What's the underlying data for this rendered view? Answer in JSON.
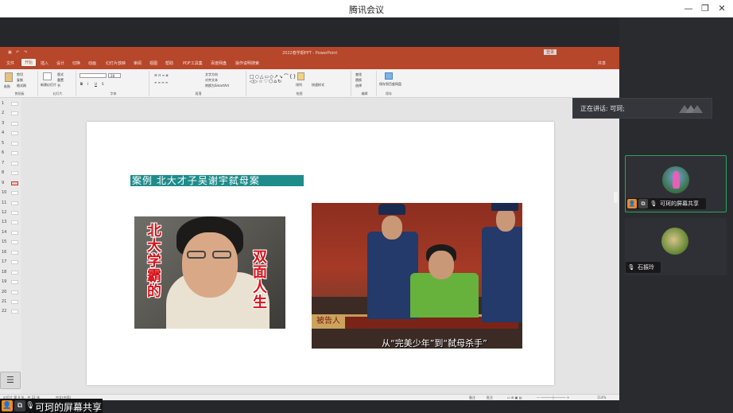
{
  "window": {
    "title": "腾讯会议",
    "minimize_glyph": "—",
    "restore_glyph": "❐",
    "close_glyph": "✕"
  },
  "ppt": {
    "title_center": "2022春学期PPT  -  PowerPoint",
    "signin": "登录",
    "share": "共享",
    "menu": [
      "文件",
      "开始",
      "插入",
      "设计",
      "切换",
      "动画",
      "幻灯片放映",
      "审阅",
      "视图",
      "帮助",
      "PDF工具集",
      "百度网盘",
      "操作说明搜索"
    ],
    "active_menu": "开始",
    "ribbon_groups": [
      {
        "label": "剪贴板",
        "items": [
          "粘贴",
          "剪切",
          "复制",
          "格式刷"
        ]
      },
      {
        "label": "幻灯片",
        "items": [
          "新建幻灯片",
          "版式",
          "重置",
          "节"
        ]
      },
      {
        "label": "字体",
        "items": [
          "B",
          "I",
          "U",
          "S",
          "28"
        ]
      },
      {
        "label": "段落",
        "items": [
          "文字方向",
          "对齐文本",
          "转换为SmartArt"
        ]
      },
      {
        "label": "绘图",
        "items": [
          "排列",
          "快速样式"
        ]
      },
      {
        "label": "编辑",
        "items": [
          "查找",
          "替换",
          "选择"
        ]
      },
      {
        "label": "保存",
        "items": [
          "保存到百度网盘"
        ]
      }
    ],
    "thumb_numbers": [
      "1",
      "2",
      "3",
      "4",
      "5",
      "6",
      "7",
      "8",
      "9",
      "10",
      "11",
      "12",
      "13",
      "14",
      "15",
      "16",
      "17",
      "18",
      "19",
      "20",
      "21",
      "22"
    ],
    "selected_thumb": "9",
    "slide": {
      "title": "案例   北大才子吴谢宇弑母案",
      "img1_text_left": [
        "北",
        "大",
        "学",
        "霸",
        "的"
      ],
      "img1_text_right": [
        "双",
        "面",
        "人",
        "生"
      ],
      "img2_caption": "从“完美少年”到“弑母杀手”",
      "img2_sign": "被告人"
    },
    "status": {
      "slide_info": "幻灯片 第 9 张，共 22 张",
      "language": "中文(中国)",
      "notes": "备注",
      "comments": "批注",
      "zoom": "114%"
    }
  },
  "meeting": {
    "speaking_label": "正在讲话: 可珂;",
    "tiles": [
      {
        "name": "可珂的屏幕共享",
        "active": true
      },
      {
        "name": "石振玲",
        "active": false
      }
    ],
    "share_label": "可珂的屏幕共享"
  },
  "colors": {
    "ppt_red": "#b7472a",
    "slide_title_bg": "#1f8c8c",
    "active_tile_border": "#2aa35e"
  }
}
